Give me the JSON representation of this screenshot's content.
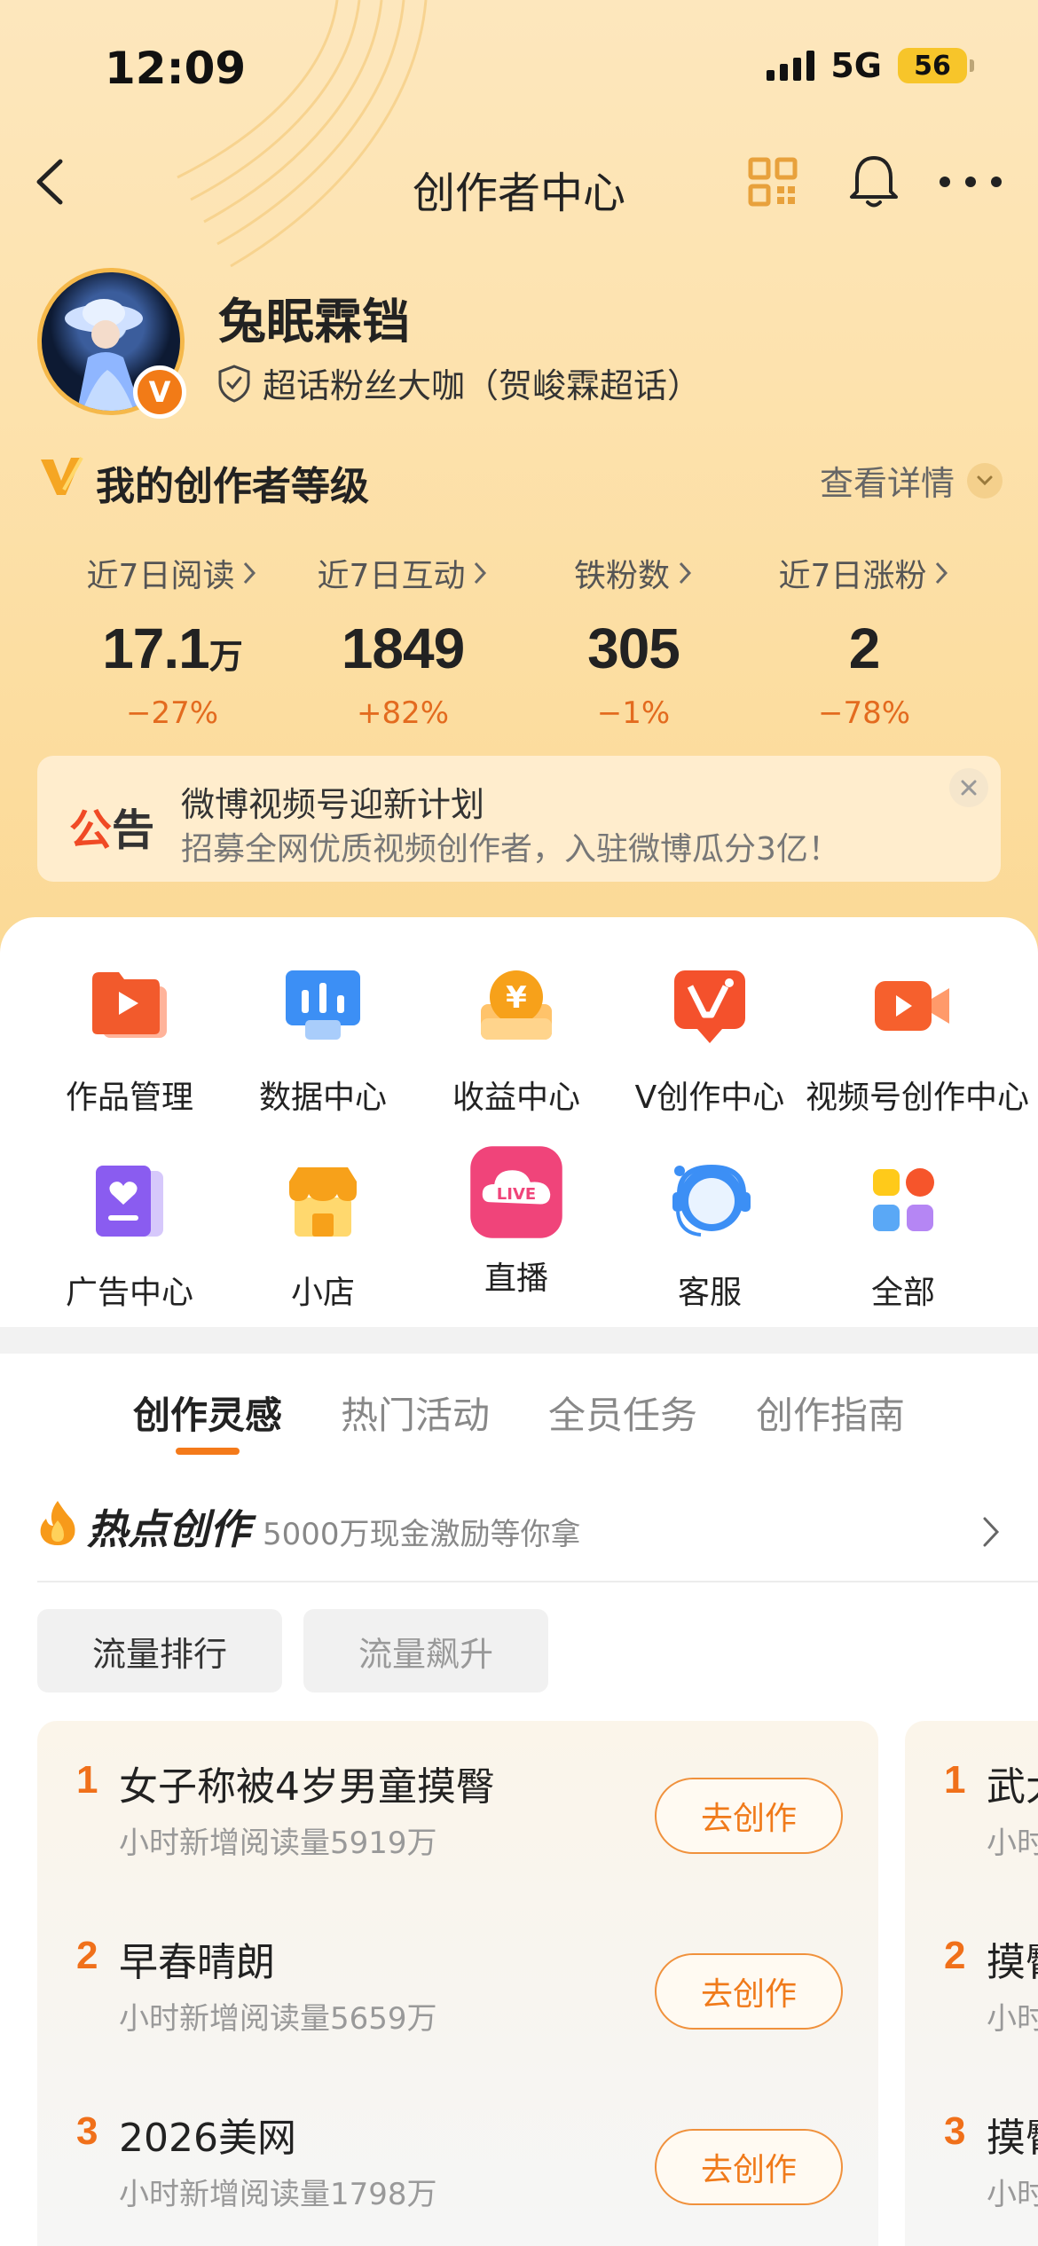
{
  "status_bar": {
    "time": "12:09",
    "network": "5G",
    "battery": "56"
  },
  "nav": {
    "title": "创作者中心"
  },
  "profile": {
    "name": "兔眠霖铛",
    "badge_text": "超话粉丝大咖（贺峻霖超话）",
    "verified_mark": "V"
  },
  "level": {
    "title": "我的创作者等级",
    "detail_label": "查看详情"
  },
  "stats": [
    {
      "label": "近7日阅读",
      "value": "17.1",
      "unit": "万",
      "change": "−27%"
    },
    {
      "label": "近7日互动",
      "value": "1849",
      "unit": "",
      "change": "+82%"
    },
    {
      "label": "铁粉数",
      "value": "305",
      "unit": "",
      "change": "−1%"
    },
    {
      "label": "近7日涨粉",
      "value": "2",
      "unit": "",
      "change": "−78%"
    }
  ],
  "notice": {
    "tag_part1": "公",
    "tag_part2": "告",
    "title": "微博视频号迎新计划",
    "subtitle": "招募全网优质视频创作者，入驻微博瓜分3亿！"
  },
  "tools": [
    {
      "label": "作品管理",
      "icon": "works-folder-icon"
    },
    {
      "label": "数据中心",
      "icon": "data-chart-icon"
    },
    {
      "label": "收益中心",
      "icon": "income-coin-icon"
    },
    {
      "label": "V创作中心",
      "icon": "v-creation-icon"
    },
    {
      "label": "视频号创作中心",
      "icon": "video-camera-icon"
    },
    {
      "label": "广告中心",
      "icon": "ad-heart-icon"
    },
    {
      "label": "小店",
      "icon": "shop-icon"
    },
    {
      "label": "直播",
      "icon": "live-icon",
      "icon_text": "LIVE"
    },
    {
      "label": "客服",
      "icon": "customer-service-icon"
    },
    {
      "label": "全部",
      "icon": "all-grid-icon"
    }
  ],
  "tabs": [
    "创作灵感",
    "热门活动",
    "全员任务",
    "创作指南"
  ],
  "hot": {
    "title": "热点创作",
    "subtitle": "5000万现金激励等你拿"
  },
  "filters": [
    "流量排行",
    "流量飙升"
  ],
  "ranking": [
    {
      "rank": "1",
      "title": "女子称被4岁男童摸臀",
      "sub": "小时新增阅读量5919万",
      "button": "去创作"
    },
    {
      "rank": "2",
      "title": "早春晴朗",
      "sub": "小时新增阅读量5659万",
      "button": "去创作"
    },
    {
      "rank": "3",
      "title": "2026美网",
      "sub": "小时新增阅读量1798万",
      "button": "去创作"
    }
  ],
  "ranking_peek": [
    {
      "rank": "1",
      "title": "武大",
      "sub": "小时"
    },
    {
      "rank": "2",
      "title": "摸臀",
      "sub": "小时"
    },
    {
      "rank": "3",
      "title": "摸臀",
      "sub": "小时"
    }
  ],
  "colors": {
    "accent": "#f07a1a",
    "hero_bg": "#fde2ad",
    "change": "#e36b1f"
  }
}
